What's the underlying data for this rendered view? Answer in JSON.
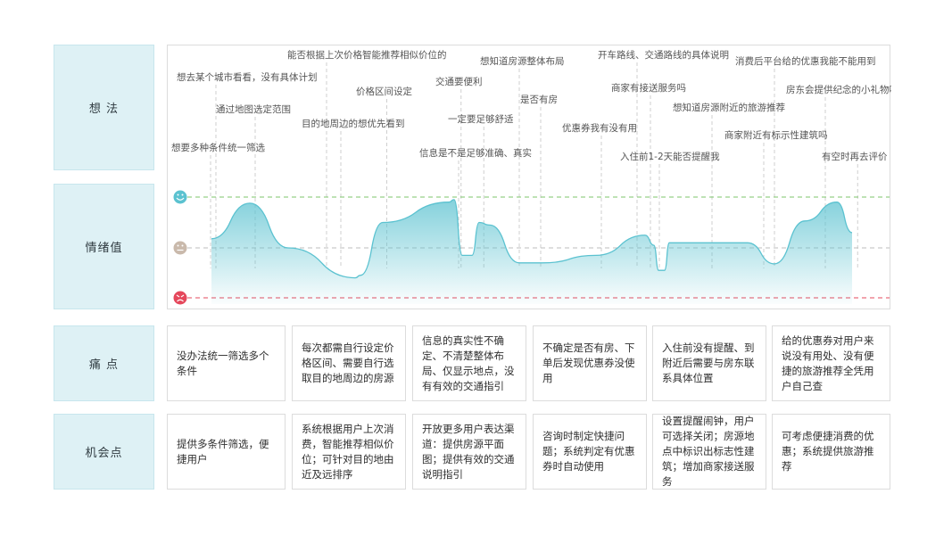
{
  "row_labels": {
    "thoughts": "想 法",
    "emotion": "情绪值",
    "pain": "痛 点",
    "opportunity": "机会点"
  },
  "thoughts": [
    "想要多种条件统一筛选",
    "想去某个城市看看，没有具体计划",
    "通过地图选定范围",
    "目的地周边的想优先看到",
    "能否根据上次价格智能推荐相似价位的",
    "价格区间设定",
    "信息是不是足够准确、真实",
    "交通要便利",
    "一定要足够舒适",
    "想知道房源整体布局",
    "是否有房",
    "优惠券我有没有用",
    "开车路线、交通路线的具体说明",
    "商家有接送服务吗",
    "入住前1-2天能否提醒我",
    "想知道房源附近的旅游推荐",
    "商家附近有标示性建筑吗",
    "消费后平台给的优惠我能不能用到",
    "房东会提供纪念的小礼物吗",
    "有空时再去评价"
  ],
  "emotion_levels": [
    "positive",
    "neutral",
    "negative"
  ],
  "emotion_curve": [
    0.18,
    0.88,
    0.0,
    -0.6,
    -0.55,
    0.5,
    0.9,
    0.95,
    -0.15,
    -0.15,
    0.5,
    0.45,
    -0.3,
    -0.3,
    -0.15,
    0.25,
    0.05,
    -0.45,
    -0.45,
    0.1,
    0.1,
    -0.32,
    0.53,
    0.9,
    0.3
  ],
  "pain_points": [
    "没办法统一筛选多个条件",
    "每次都需自行设定价格区间、需要自行选取目的地周边的房源",
    "信息的真实性不确定、不清楚整体布局、仅显示地点，没有有效的交通指引",
    "不确定是否有房、下单后发现优惠券没使用",
    "入住前没有提醒、到附近后需要与房东联系具体位置",
    "给的优惠券对用户来说没有用处、没有便捷的旅游推荐全凭用户自己查"
  ],
  "opportunities": [
    "提供多条件筛选，便捷用户",
    "系统根据用户上次消费，智能推荐相似价位；可针对目的地由近及远排序",
    "开放更多用户表达渠道：提供房源平面图；提供有效的交通说明指引",
    "咨询时制定快捷问题；系统判定有优惠券时自动使用",
    "设置提醒闹钟，用户可选择关闭；房源地点中标识出标志性建筑；增加商家接送服务",
    "可考虑便捷消费的优惠；系统提供旅游推荐"
  ],
  "colors": {
    "accent": "#5bc2d0",
    "label_bg": "#def1f5",
    "positive_line": "#7cc46b",
    "neutral_line": "#b9b9b9",
    "negative_line": "#e5485c"
  }
}
